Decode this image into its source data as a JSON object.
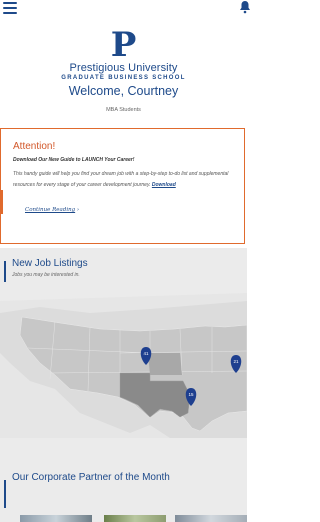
{
  "header": {
    "logo_letter": "P",
    "university": "Prestigious University",
    "school": "GRADUATE BUSINESS SCHOOL",
    "welcome": "Welcome, Courtney",
    "group": "MBA Students"
  },
  "attention": {
    "title": "Attention!",
    "headline": "Download Our New Guide to LAUNCH Your Career!",
    "body": "This handy guide will help you find your dream job with a step-by-step to-do list and supplemental resources for every stage of your career development journey.",
    "download_label": "Download",
    "continue_label": "Continue Reading",
    "continue_arrow": "›"
  },
  "jobs": {
    "title": "New Job Listings",
    "subtitle": "Jobs you may be interested in.",
    "pins": [
      {
        "label": "41"
      },
      {
        "label": "21"
      },
      {
        "label": "15"
      }
    ]
  },
  "partner": {
    "title": "Our Corporate Partner of the Month"
  },
  "colors": {
    "brand_blue": "#1e4a8a",
    "attention_orange": "#e06a2d"
  }
}
